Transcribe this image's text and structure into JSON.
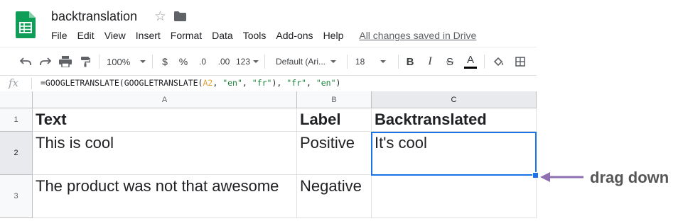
{
  "header": {
    "doc_title": "backtranslation",
    "saved_status": "All changes saved in Drive"
  },
  "menu": [
    "File",
    "Edit",
    "View",
    "Insert",
    "Format",
    "Data",
    "Tools",
    "Add-ons",
    "Help"
  ],
  "toolbar": {
    "zoom": "100%",
    "currency": "$",
    "percent": "%",
    "decrease_decimals": ".0",
    "increase_decimals": ".00",
    "more_formats": "123",
    "font": "Default (Ari...",
    "font_size": "18",
    "bold": "B",
    "italic": "I",
    "strikethrough": "S",
    "text_color": "A",
    "text_color_value": "#000000"
  },
  "formula_bar": {
    "fx": "fx",
    "formula_parts": [
      "=GOOGLETRANSLATE(GOOGLETRANSLATE(",
      "A2",
      ", ",
      "\"en\"",
      ", ",
      "\"fr\"",
      "), ",
      "\"fr\"",
      ", ",
      "\"en\"",
      ")"
    ]
  },
  "sheet": {
    "columns": [
      "A",
      "B",
      "C"
    ],
    "rows": [
      "1",
      "2",
      "3"
    ],
    "cells": {
      "r1": [
        "Text",
        "Label",
        "Backtranslated"
      ],
      "r2": [
        "This is cool",
        "Positive",
        "It's cool"
      ],
      "r3": [
        "The product was not that awesome",
        "Negative",
        ""
      ]
    },
    "selected_cell": "C2"
  },
  "annotation": {
    "label": "drag down",
    "color": "#8e6fb0"
  },
  "colors": {
    "selection": "#1a73e8",
    "sheets_green": "#0f9d58"
  }
}
